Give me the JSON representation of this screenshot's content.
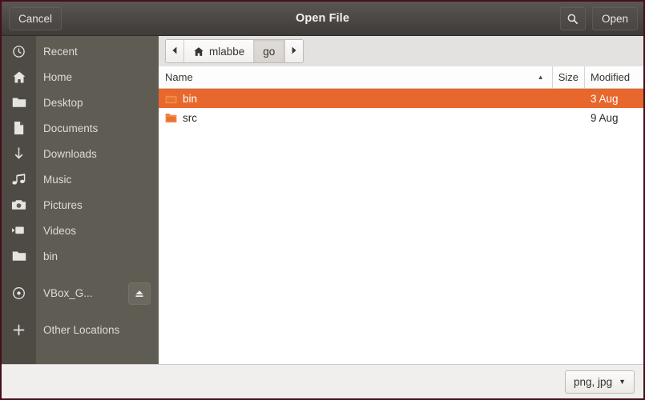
{
  "window": {
    "title": "Open File",
    "cancel_label": "Cancel",
    "open_label": "Open",
    "search_icon": "search-icon"
  },
  "sidebar": {
    "items": [
      {
        "label": "Recent",
        "icon": "clock-icon"
      },
      {
        "label": "Home",
        "icon": "home-icon"
      },
      {
        "label": "Desktop",
        "icon": "folder-icon"
      },
      {
        "label": "Documents",
        "icon": "document-icon"
      },
      {
        "label": "Downloads",
        "icon": "download-icon"
      },
      {
        "label": "Music",
        "icon": "music-note-icon"
      },
      {
        "label": "Pictures",
        "icon": "camera-icon"
      },
      {
        "label": "Videos",
        "icon": "video-camera-icon"
      },
      {
        "label": "bin",
        "icon": "folder-icon"
      },
      {
        "label": "VBox_G...",
        "icon": "disc-icon",
        "eject": true
      },
      {
        "label": "Other Locations",
        "icon": "plus-icon"
      }
    ]
  },
  "pathbar": {
    "back_arrow": "chevron-left-icon",
    "forward_arrow": "chevron-right-icon",
    "crumbs": [
      {
        "label": "mlabbe",
        "icon": "home-icon",
        "active": false
      },
      {
        "label": "go",
        "icon": "",
        "active": true
      }
    ]
  },
  "filelist": {
    "columns": [
      {
        "key": "name",
        "label": "Name",
        "sorted": true,
        "sort_indicator": "▲"
      },
      {
        "key": "size",
        "label": "Size"
      },
      {
        "key": "modified",
        "label": "Modified"
      }
    ],
    "rows": [
      {
        "name": "bin",
        "size": "",
        "modified": "3 Aug",
        "icon": "folder-icon",
        "selected": true
      },
      {
        "name": "src",
        "size": "",
        "modified": "9 Aug",
        "icon": "folder-icon",
        "selected": false
      }
    ]
  },
  "bottombar": {
    "filter_label": "png, jpg",
    "filter_caret": "▼"
  },
  "colors": {
    "accent_selection": "#e8672c",
    "titlebar_dark": "#4b4744",
    "sidebar_bg": "#5f5c53",
    "sidebar_icon_col": "#4e4b44",
    "window_border": "#4a0d1a",
    "bottombar_bg": "#f0efed",
    "pathbar_bg": "#e4e2e0"
  }
}
